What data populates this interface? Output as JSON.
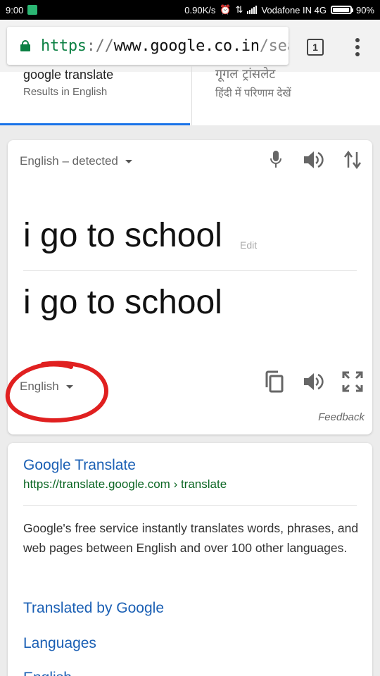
{
  "status_bar": {
    "time": "9:00",
    "speed": "0.90K/s",
    "carrier": "Vodafone IN 4G",
    "battery": "90%"
  },
  "browser": {
    "url_scheme": "https",
    "url_sep": "://",
    "url_host": "www.google.co.in",
    "url_path": "/sear",
    "tab_count": "1"
  },
  "language_tabs": [
    {
      "title": "google translate",
      "subtitle": "Results in English"
    },
    {
      "title": "गूगल ट्रांसलेट",
      "subtitle": "हिंदी में परिणाम देखें"
    }
  ],
  "translate_card": {
    "source_language": "English – detected",
    "source_text": "i go to school",
    "edit_label": "Edit",
    "translated_text": "i go to school",
    "target_language": "English",
    "feedback_label": "Feedback"
  },
  "result": {
    "title": "Google Translate",
    "url": "https://translate.google.com › translate",
    "description": "Google's free service instantly translates words, phrases, and web pages between English and over 100 other languages.",
    "sitelinks": [
      "Translated by Google",
      "Languages",
      "English"
    ]
  },
  "colors": {
    "link": "#1a5fb4",
    "url_green": "#0b6623",
    "tab_accent": "#1a73e8",
    "annotation_red": "#e02020"
  }
}
